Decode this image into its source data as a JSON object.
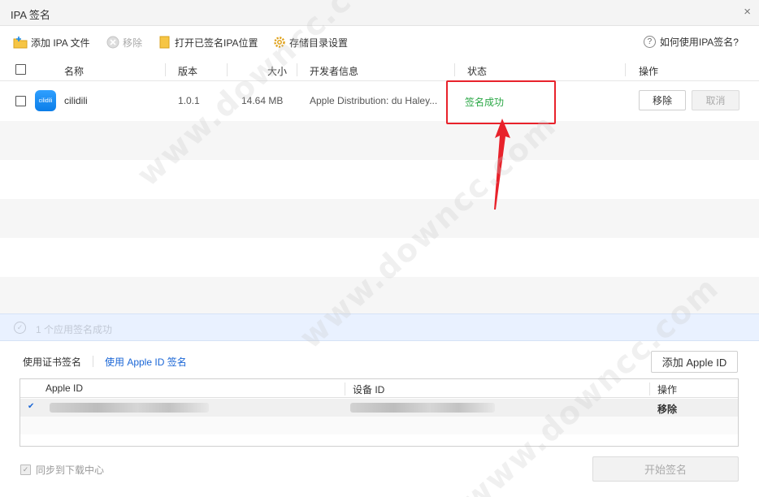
{
  "window": {
    "title": "IPA 签名",
    "close_glyph": "×"
  },
  "toolbar": {
    "add_ipa": "添加 IPA 文件",
    "remove": "移除",
    "open_signed_location": "打开已签名IPA位置",
    "storage_settings": "存储目录设置",
    "help": "如何使用IPA签名?"
  },
  "table": {
    "columns": [
      "名称",
      "版本",
      "大小",
      "开发者信息",
      "状态",
      "操作"
    ],
    "rows": [
      {
        "icon_text": "cilidili",
        "name": "cilidili",
        "version": "1.0.1",
        "size": "14.64 MB",
        "developer": "Apple Distribution: du Haley...",
        "status": "签名成功",
        "remove_label": "移除",
        "cancel_label": "取消"
      }
    ]
  },
  "status_bar": {
    "message": "1 个应用签名成功"
  },
  "sign_tabs": {
    "certificate": "使用证书签名",
    "apple_id": "使用 Apple ID 签名"
  },
  "add_apple_id": "添加 Apple ID",
  "account_table": {
    "columns": [
      "Apple ID",
      "设备 ID",
      "操作"
    ],
    "rows": [
      {
        "checked_glyph": "✔",
        "action": "移除"
      }
    ]
  },
  "sync_label": "同步到下载中心",
  "start_sign": "开始签名",
  "watermark": "www.downcc.com",
  "colors": {
    "success": "#2aa745",
    "link": "#1a66d6",
    "annotation": "#e8222b",
    "info_bar": "#e9f1ff"
  }
}
